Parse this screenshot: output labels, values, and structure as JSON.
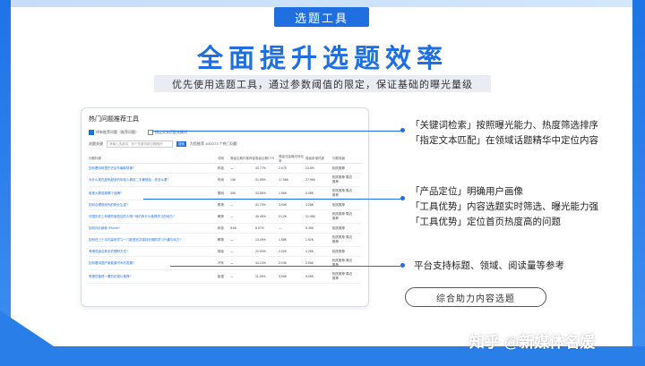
{
  "badge": "选题工具",
  "headline": "全面提升选题效率",
  "subline": "优先使用选题工具，通过参数阈值的限定，保证基础的曝光量级",
  "panel": {
    "title": "热门问题推荐工具",
    "checkboxes": [
      "所有推荐问题（推荐问题）",
      "指定文本匹配关键词"
    ],
    "search_label": "选题关键",
    "search_placeholder": "请输入关键词，多个关键词用空格隔开",
    "search_button": "搜索",
    "result_note": "为您推荐 100/273 个热门问题",
    "columns": [
      "问题标题",
      "领域",
      "周级近期内推荐量",
      "周级近期CTR",
      "周级流量曝光转化率",
      "周级新增热度",
      "问题收藏"
    ],
    "rows": [
      [
        "如何看待阿里巴巴京东最新财报?",
        "科技",
        "—",
        "33.77%",
        "2.07K",
        "23.5%",
        "相关推荐"
      ],
      [
        "为什么现在越来越多的年轻人喜欢二手奢侈品，你怎么看?",
        "时尚",
        "13K",
        "31.95%",
        "17.96K",
        "27.96K",
        "相关推荐 周边推荐"
      ],
      [
        "电视大屏选择哪个品牌?",
        "数码",
        "30K",
        "33.85%",
        "1.96K",
        "5.08K",
        "相关推荐 周边推荐"
      ],
      [
        "如何合理规划你的职业生涯?",
        "职场",
        "—",
        "31.73%",
        "3.99K",
        "3.28K",
        "相关推荐"
      ],
      [
        "中国历史上有哪些被低估的人物? 他们有什么值得学习的地方?",
        "教育",
        "—",
        "35.45%",
        "2.12K",
        "21.05K",
        "相关推荐 周边推荐"
      ],
      [
        "如何评价新款 iPhone?",
        "科技",
        "5.6K",
        "8.97%",
        "—",
        "5.45K",
        "相关推荐"
      ],
      [
        "如何在三个月内高效学习一门新语言并保持长期的学习兴趣与动力?",
        "教育",
        "—",
        "13.49%",
        "1.58K",
        "1.92K",
        "相关推荐 周边推荐"
      ],
      [
        "有哪些适合新手的理财方式?",
        "财经",
        "—",
        "20.00%",
        "2.02K",
        "4.28K",
        "相关推荐"
      ],
      [
        "如何看待国产新能源汽车的发展?",
        "汽车",
        "—",
        "34.13%",
        "2.03K",
        "2.55K",
        "相关推荐 周边推荐"
      ],
      [
        "有哪些值得一看的纪录片推荐?",
        "影视",
        "—",
        "11.18%",
        "3.50K",
        "5.05K",
        "相关推荐 周边推荐"
      ]
    ]
  },
  "annotations": {
    "group1": [
      "「关键词检索」按照曝光能力、热度筛选排序",
      "「指定文本匹配」在领域话题精华中定位内容"
    ],
    "group2": [
      "「产品定位」明确用户画像",
      "「工具优势」内容选题实时筛选、曝光能力强",
      "「工具优势」定位首页热度高的问题"
    ],
    "group3": [
      "平台支持标题、领域、阅读量等参考"
    ]
  },
  "pill_label": "综合助力内容选题",
  "watermark": "知乎 @新媒体名媛",
  "colors": {
    "accent": "#1f6fe0",
    "frame": "#2a7ee8"
  }
}
